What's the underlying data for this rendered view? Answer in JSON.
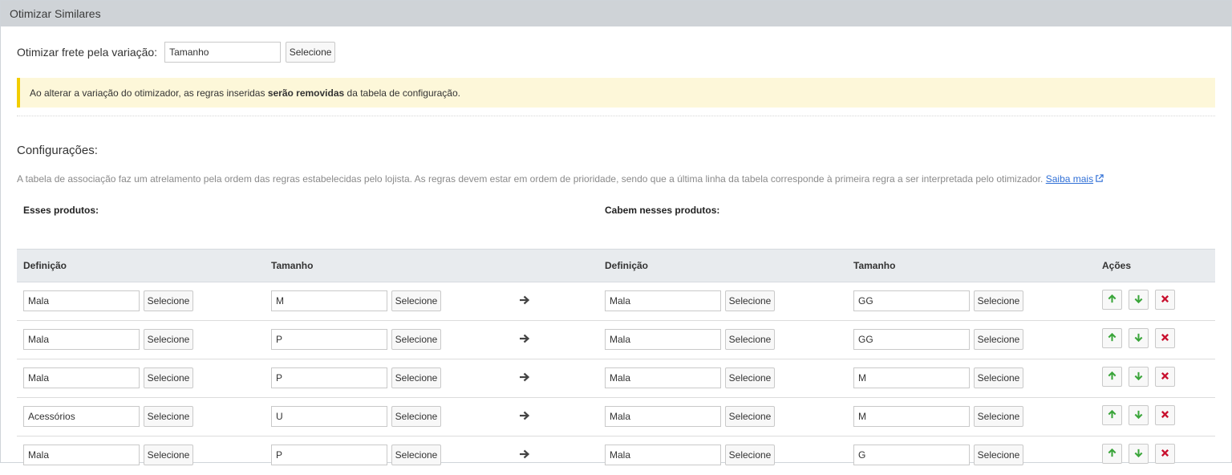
{
  "panel": {
    "title": "Otimizar Similares"
  },
  "variation": {
    "label": "Otimizar frete pela variação:",
    "value": "Tamanho",
    "select_label": "Selecione"
  },
  "alert": {
    "prefix": "Ao alterar a variação do otimizador, as regras inseridas ",
    "bold": "serão removidas",
    "suffix": " da tabela de configuração."
  },
  "config": {
    "title": "Configurações:",
    "description": "A tabela de associação faz um atrelamento pela ordem das regras estabelecidas pelo lojista. As regras devem estar em ordem de prioridade, sendo que a última linha da tabela corresponde à primeira regra a ser interpretada pelo otimizador.",
    "link_text": "Saiba mais"
  },
  "groups": {
    "left": "Esses produtos:",
    "right": "Cabem nesses produtos:"
  },
  "table": {
    "headers": [
      "Definição",
      "Tamanho",
      "Definição",
      "Tamanho",
      "Ações"
    ],
    "select_label": "Selecione",
    "rows": [
      {
        "def_a": "Mala",
        "size_a": "M",
        "def_b": "Mala",
        "size_b": "GG"
      },
      {
        "def_a": "Mala",
        "size_a": "P",
        "def_b": "Mala",
        "size_b": "GG"
      },
      {
        "def_a": "Mala",
        "size_a": "P",
        "def_b": "Mala",
        "size_b": "M"
      },
      {
        "def_a": "Acessórios",
        "size_a": "U",
        "def_b": "Mala",
        "size_b": "M"
      },
      {
        "def_a": "Mala",
        "size_a": "P",
        "def_b": "Mala",
        "size_b": "G"
      }
    ]
  },
  "icons": {
    "arrow": "arrow-right-icon",
    "up": "arrow-up-icon",
    "down": "arrow-down-icon",
    "delete": "close-icon",
    "external": "external-link-icon"
  },
  "colors": {
    "header_bg": "#cfd3d7",
    "alert_bg": "#fdf7d9",
    "alert_border": "#f2cd00",
    "link": "#2f6fd6",
    "up_down": "#3aa53a",
    "delete": "#c8102e"
  }
}
